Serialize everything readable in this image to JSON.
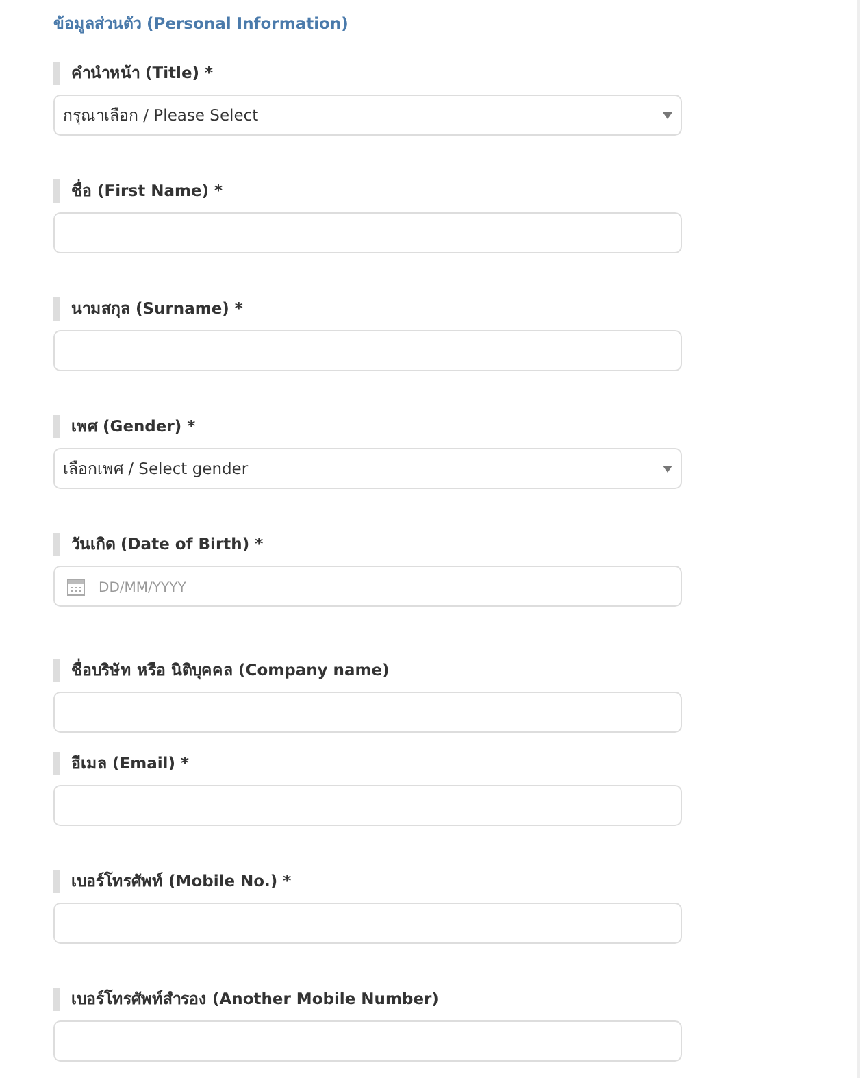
{
  "section_title": "ข้อมูลส่วนตัว (Personal Information)",
  "fields": [
    {
      "kind": "select",
      "label": "คำนำหน้า (Title) *",
      "value": "กรุณาเลือก / Please Select"
    },
    {
      "kind": "text",
      "label": "ชื่อ (First Name) *"
    },
    {
      "kind": "text",
      "label": "นามสกุล (Surname) *"
    },
    {
      "kind": "select",
      "label": "เพศ (Gender) *",
      "value": "เลือกเพศ / Select gender"
    },
    {
      "kind": "date",
      "label": "วันเกิด (Date of Birth) *",
      "placeholder": "DD/MM/YYYY"
    },
    {
      "kind": "text",
      "label": "ชื่อบริษัท หรือ นิติบุคคล (Company name)"
    },
    {
      "kind": "text",
      "label": "อีเมล (Email) *"
    },
    {
      "kind": "text",
      "label": "เบอร์โทรศัพท์ (Mobile No.) *"
    },
    {
      "kind": "text",
      "label": "เบอร์โทรศัพท์สำรอง (Another Mobile Number)"
    }
  ]
}
